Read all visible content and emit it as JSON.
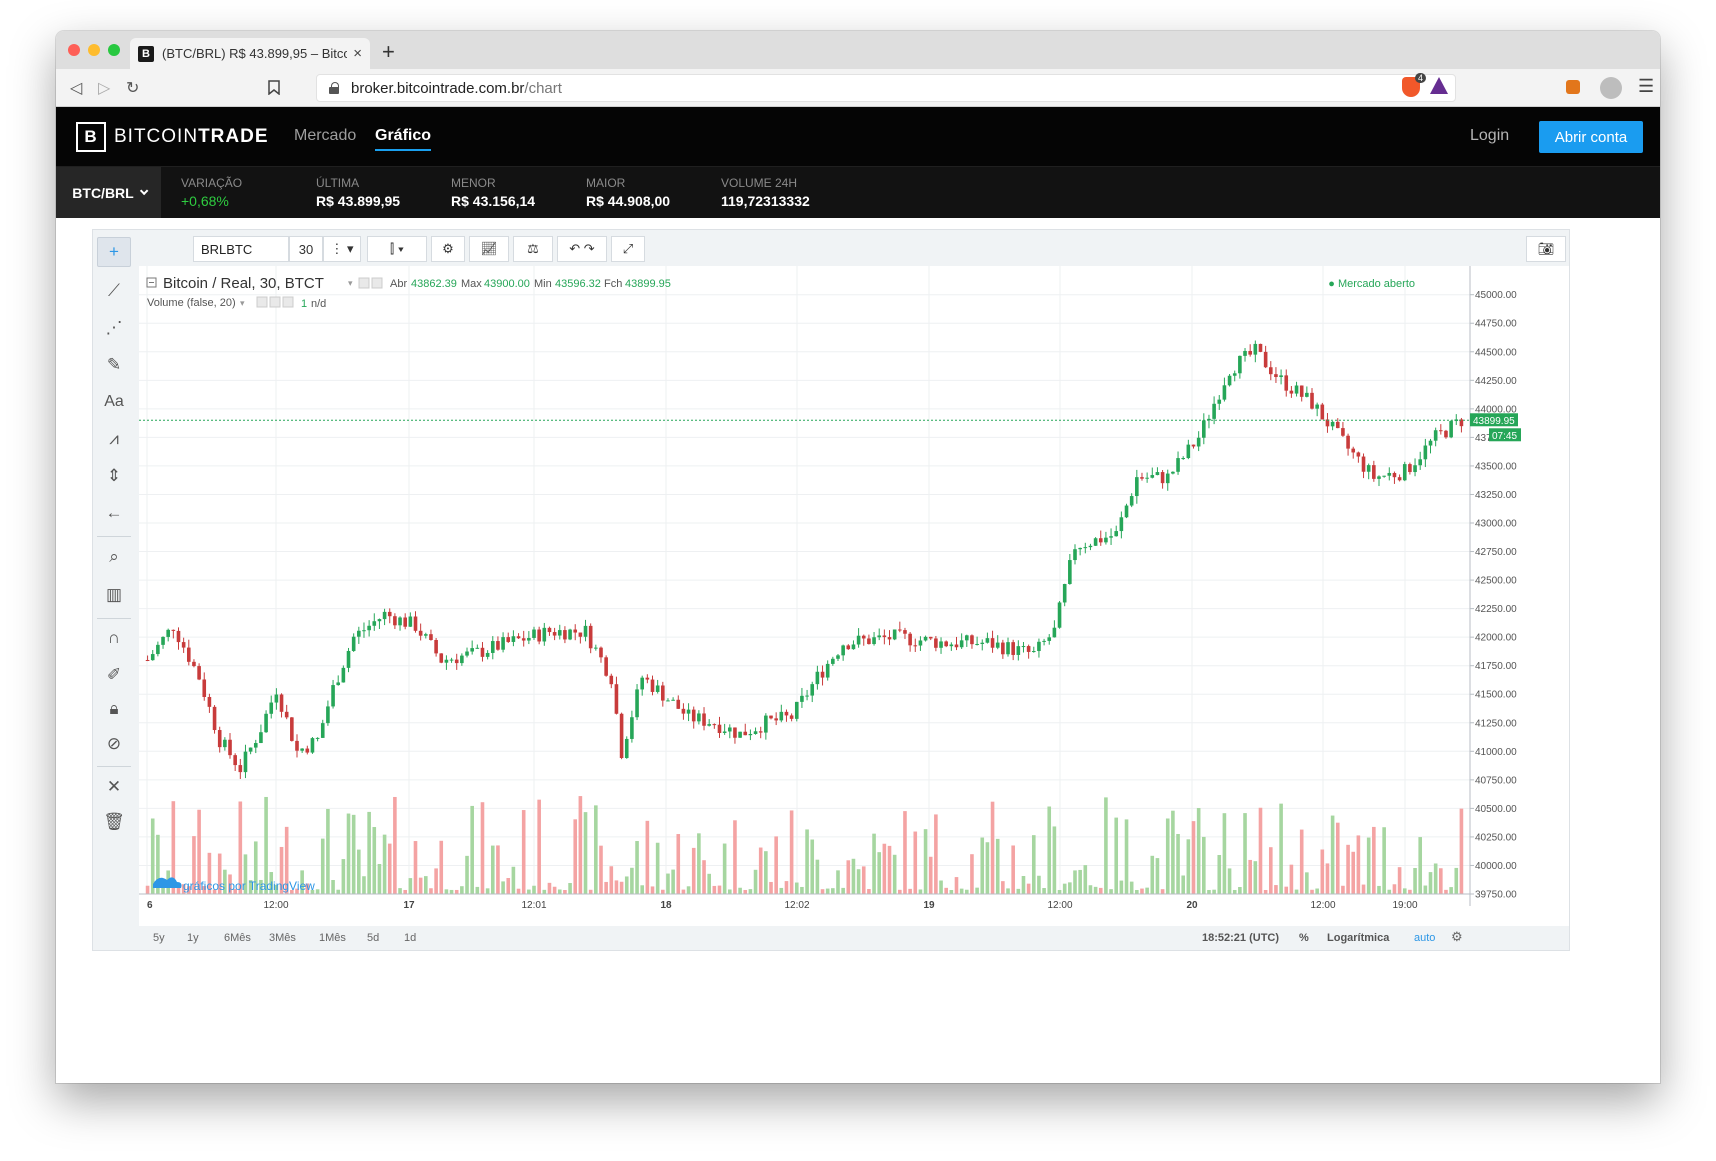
{
  "browser": {
    "tab_title": "(BTC/BRL) R$ 43.899,95 – Bitcoi",
    "tab_favicon": "B",
    "tab_close": "×",
    "new_tab": "+",
    "url_domain": "broker.bitcointrade.com.br",
    "url_path": "/chart",
    "brave_badge": "4"
  },
  "site": {
    "logo_mark": "B",
    "logo_light": "BITCOIN",
    "logo_bold": "TRADE",
    "nav": [
      "Mercado",
      "Gráfico"
    ],
    "login": "Login",
    "signup": "Abrir conta"
  },
  "ticker": {
    "pair": "BTC/BRL",
    "stats": [
      {
        "label": "VARIAÇÃO",
        "value": "+0,68%"
      },
      {
        "label": "ÚLTIMA",
        "value": "R$ 43.899,95"
      },
      {
        "label": "MENOR",
        "value": "R$ 43.156,14"
      },
      {
        "label": "MAIOR",
        "value": "R$ 44.908,00"
      },
      {
        "label": "VOLUME 24H",
        "value": "119,72313332"
      }
    ]
  },
  "toolbar": {
    "symbol": "BRLBTC",
    "interval": "30"
  },
  "legend": {
    "title": "Bitcoin / Real, 30, BTCT",
    "o_label": "Abr",
    "o": "43862.39",
    "h_label": "Max",
    "h": "43900.00",
    "l_label": "Min",
    "l": "43596.32",
    "c_label": "Fch",
    "c": "43899.95",
    "volume_label": "Volume (false, 20)",
    "volume_value": "1",
    "volume_nd": "n/d",
    "market_status": "● Mercado aberto",
    "watermark": "gráficos por TradingView"
  },
  "bottom": {
    "ranges": [
      "5y",
      "1y",
      "6Mês",
      "3Mês",
      "1Mês",
      "5d",
      "1d"
    ],
    "time": "18:52:21 (UTC)",
    "percent": "%",
    "log": "Logarítmica",
    "auto": "auto"
  },
  "colors": {
    "up": "#26a658",
    "down": "#c83b3b",
    "vol_up": "#a6d6a0",
    "vol_down": "#f4a3a3",
    "accent": "#1a9cf0"
  },
  "chart_data": {
    "type": "candlestick",
    "title": "Bitcoin / Real, 30, BTCT",
    "y_ticks": [
      45000,
      44750,
      44500,
      44250,
      44000,
      43750,
      43500,
      43250,
      43000,
      42750,
      42500,
      42250,
      42000,
      41750,
      41500,
      41250,
      41000,
      40750,
      40500,
      40250,
      40000,
      39750
    ],
    "ylim": [
      39750,
      45050
    ],
    "y_tick_labels": [
      "45000.00",
      "44750.00",
      "44500.00",
      "44250.00",
      "44000.00",
      "43750.00",
      "43500.00",
      "43250.00",
      "43000.00",
      "42750.00",
      "42500.00",
      "42250.00",
      "42000.00",
      "41750.00",
      "41500.00",
      "41250.00",
      "41000.00",
      "40750.00",
      "40500.00",
      "40250.00",
      "40000.00",
      "39750.00"
    ],
    "x_ticks": [
      "6",
      "12:00",
      "17",
      "12:01",
      "18",
      "12:02",
      "19",
      "12:00",
      "20",
      "12:00",
      "19:00"
    ],
    "last_price": "43899.95",
    "last_price_value": 43899.95,
    "countdown": "07:45",
    "price_anchors": [
      [
        0,
        41800
      ],
      [
        5,
        42100
      ],
      [
        10,
        41650
      ],
      [
        14,
        41100
      ],
      [
        18,
        40850
      ],
      [
        22,
        41200
      ],
      [
        25,
        41550
      ],
      [
        29,
        41000
      ],
      [
        33,
        41100
      ],
      [
        36,
        41550
      ],
      [
        40,
        42000
      ],
      [
        46,
        42200
      ],
      [
        52,
        42100
      ],
      [
        57,
        41800
      ],
      [
        63,
        41850
      ],
      [
        70,
        41950
      ],
      [
        78,
        42050
      ],
      [
        85,
        42050
      ],
      [
        90,
        41650
      ],
      [
        92,
        41000
      ],
      [
        96,
        41650
      ],
      [
        100,
        41500
      ],
      [
        105,
        41300
      ],
      [
        110,
        41250
      ],
      [
        115,
        41150
      ],
      [
        120,
        41250
      ],
      [
        125,
        41300
      ],
      [
        130,
        41650
      ],
      [
        135,
        41950
      ],
      [
        145,
        42000
      ],
      [
        155,
        41950
      ],
      [
        163,
        41950
      ],
      [
        172,
        41850
      ],
      [
        176,
        42050
      ],
      [
        180,
        42800
      ],
      [
        188,
        42900
      ],
      [
        192,
        43400
      ],
      [
        198,
        43400
      ],
      [
        204,
        43750
      ],
      [
        210,
        44350
      ],
      [
        215,
        44500
      ],
      [
        220,
        44250
      ],
      [
        226,
        44050
      ],
      [
        233,
        43650
      ],
      [
        238,
        43400
      ],
      [
        244,
        43450
      ],
      [
        250,
        43750
      ],
      [
        255,
        43900
      ]
    ]
  }
}
